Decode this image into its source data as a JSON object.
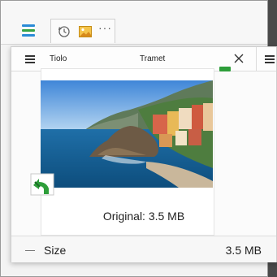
{
  "toolbar": {
    "app_icon": "stacked-lines-icon",
    "history_icon": "history-icon",
    "image_icon": "image-icon",
    "more": "···"
  },
  "dialog": {
    "menu_icon": "hamburger-menu-icon",
    "header_left": "Tiolo",
    "header_center": "Tramet",
    "close_icon": "close-icon",
    "preview_caption": "Original: 3.5 MB",
    "badge_icon": "green-refresh-icon",
    "footer_label": "Size",
    "footer_value": "3.5 MB"
  },
  "colors": {
    "accent_green": "#2e9e3a",
    "icon_blue": "#2a8bd6",
    "icon_green": "#36a343"
  }
}
